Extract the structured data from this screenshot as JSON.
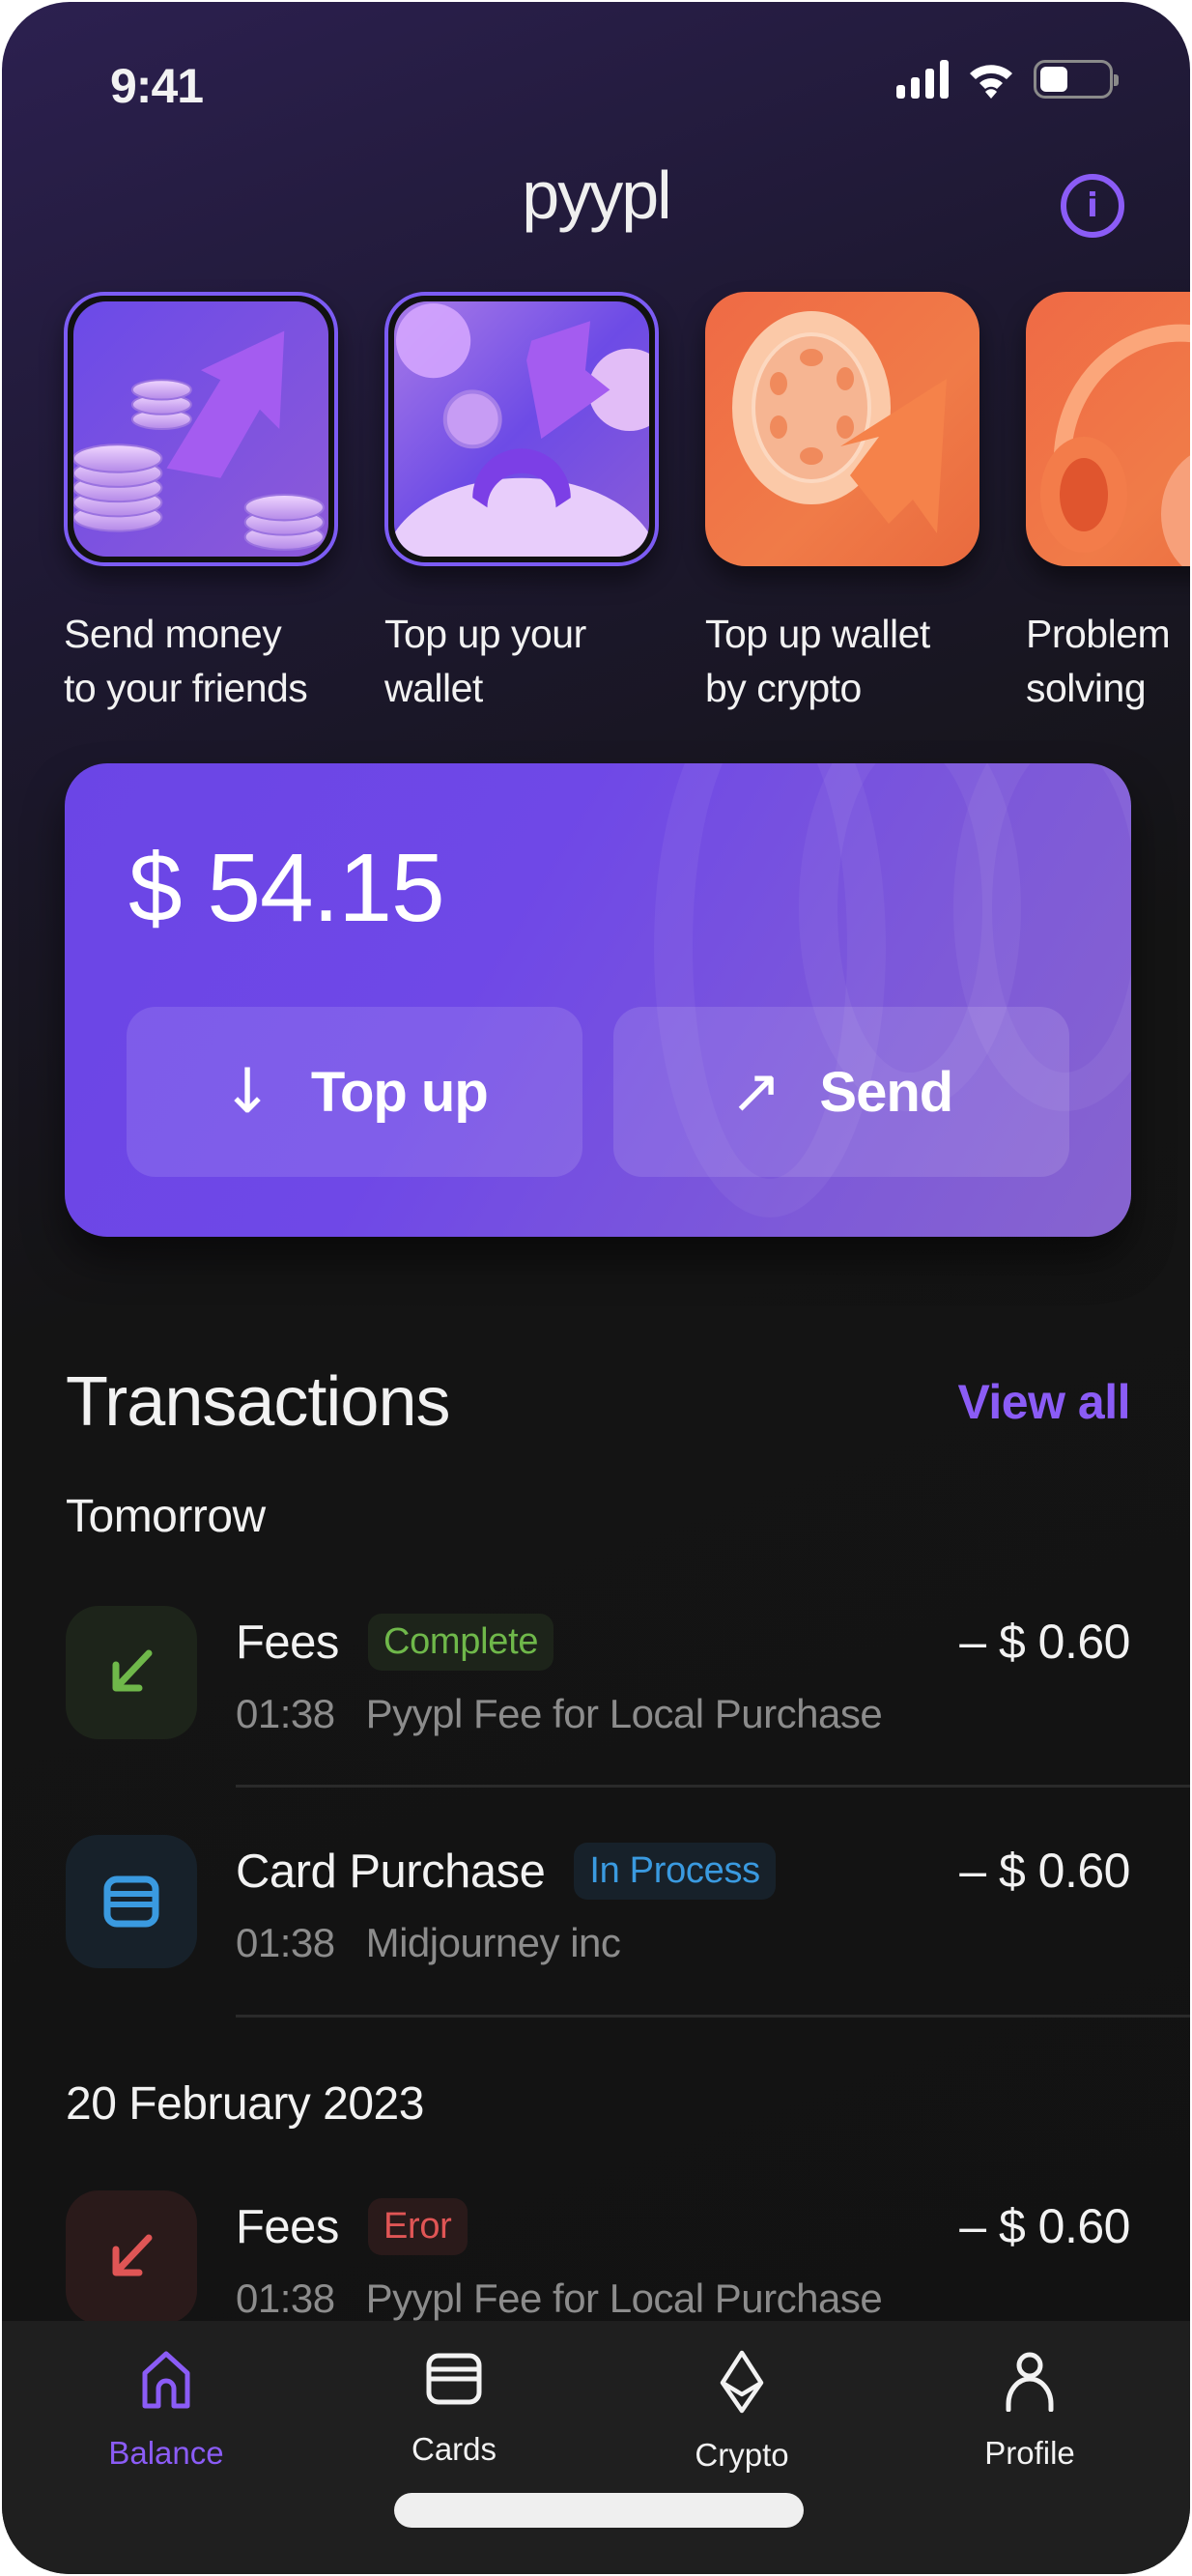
{
  "status_bar": {
    "time": "9:41",
    "icons": [
      "cellular-signal-icon",
      "wifi-icon",
      "battery-icon"
    ]
  },
  "header": {
    "logo": "pyypl",
    "info_icon": "info-icon",
    "info_glyph": "i"
  },
  "stories": [
    {
      "label_line1": "Send money",
      "label_line2": "to your friends",
      "selected": true,
      "theme": "purple"
    },
    {
      "label_line1": "Top up your",
      "label_line2": "wallet",
      "selected": true,
      "theme": "purple"
    },
    {
      "label_line1": "Top up wallet",
      "label_line2": "by crypto",
      "selected": false,
      "theme": "orange"
    },
    {
      "label_line1": "Problem",
      "label_line2": "solving",
      "selected": false,
      "theme": "orange"
    }
  ],
  "balance": {
    "amount": "$ 54.15",
    "top_up_label": "Top up",
    "top_up_icon": "↓",
    "send_label": "Send",
    "send_icon": "↗"
  },
  "transactions": {
    "title": "Transactions",
    "view_all": "View all",
    "groups": [
      {
        "label": "Tomorrow",
        "items": [
          {
            "name": "Fees",
            "status": "Complete",
            "time": "01:38",
            "description": "Pyypl Fee for Local Purchase",
            "amount": "– $ 0.60",
            "icon": "arrow-down-left-icon",
            "status_color": "#6fb84a"
          },
          {
            "name": "Card Purchase",
            "status": "In Process",
            "time": "01:38",
            "description": "Midjourney inc",
            "amount": "– $ 0.60",
            "icon": "card-icon",
            "status_color": "#3a9ae0"
          }
        ]
      },
      {
        "label": "20 February 2023",
        "items": [
          {
            "name": "Fees",
            "status": "Eror",
            "time": "01:38",
            "description": "Pyypl Fee for Local Purchase",
            "amount": "– $ 0.60",
            "icon": "arrow-down-left-icon",
            "status_color": "#e05555"
          }
        ]
      }
    ]
  },
  "tabbar": {
    "tabs": [
      {
        "label": "Balance",
        "icon": "home-icon",
        "active": true
      },
      {
        "label": "Cards",
        "icon": "card-icon",
        "active": false
      },
      {
        "label": "Crypto",
        "icon": "ethereum-icon",
        "active": false
      },
      {
        "label": "Profile",
        "icon": "person-icon",
        "active": false
      }
    ]
  },
  "colors": {
    "accent": "#8b5cf6",
    "card_gradient_start": "#6b45e6",
    "card_gradient_end": "#8764cf",
    "success": "#6fb84a",
    "info": "#3a9ae0",
    "error": "#e05555"
  }
}
